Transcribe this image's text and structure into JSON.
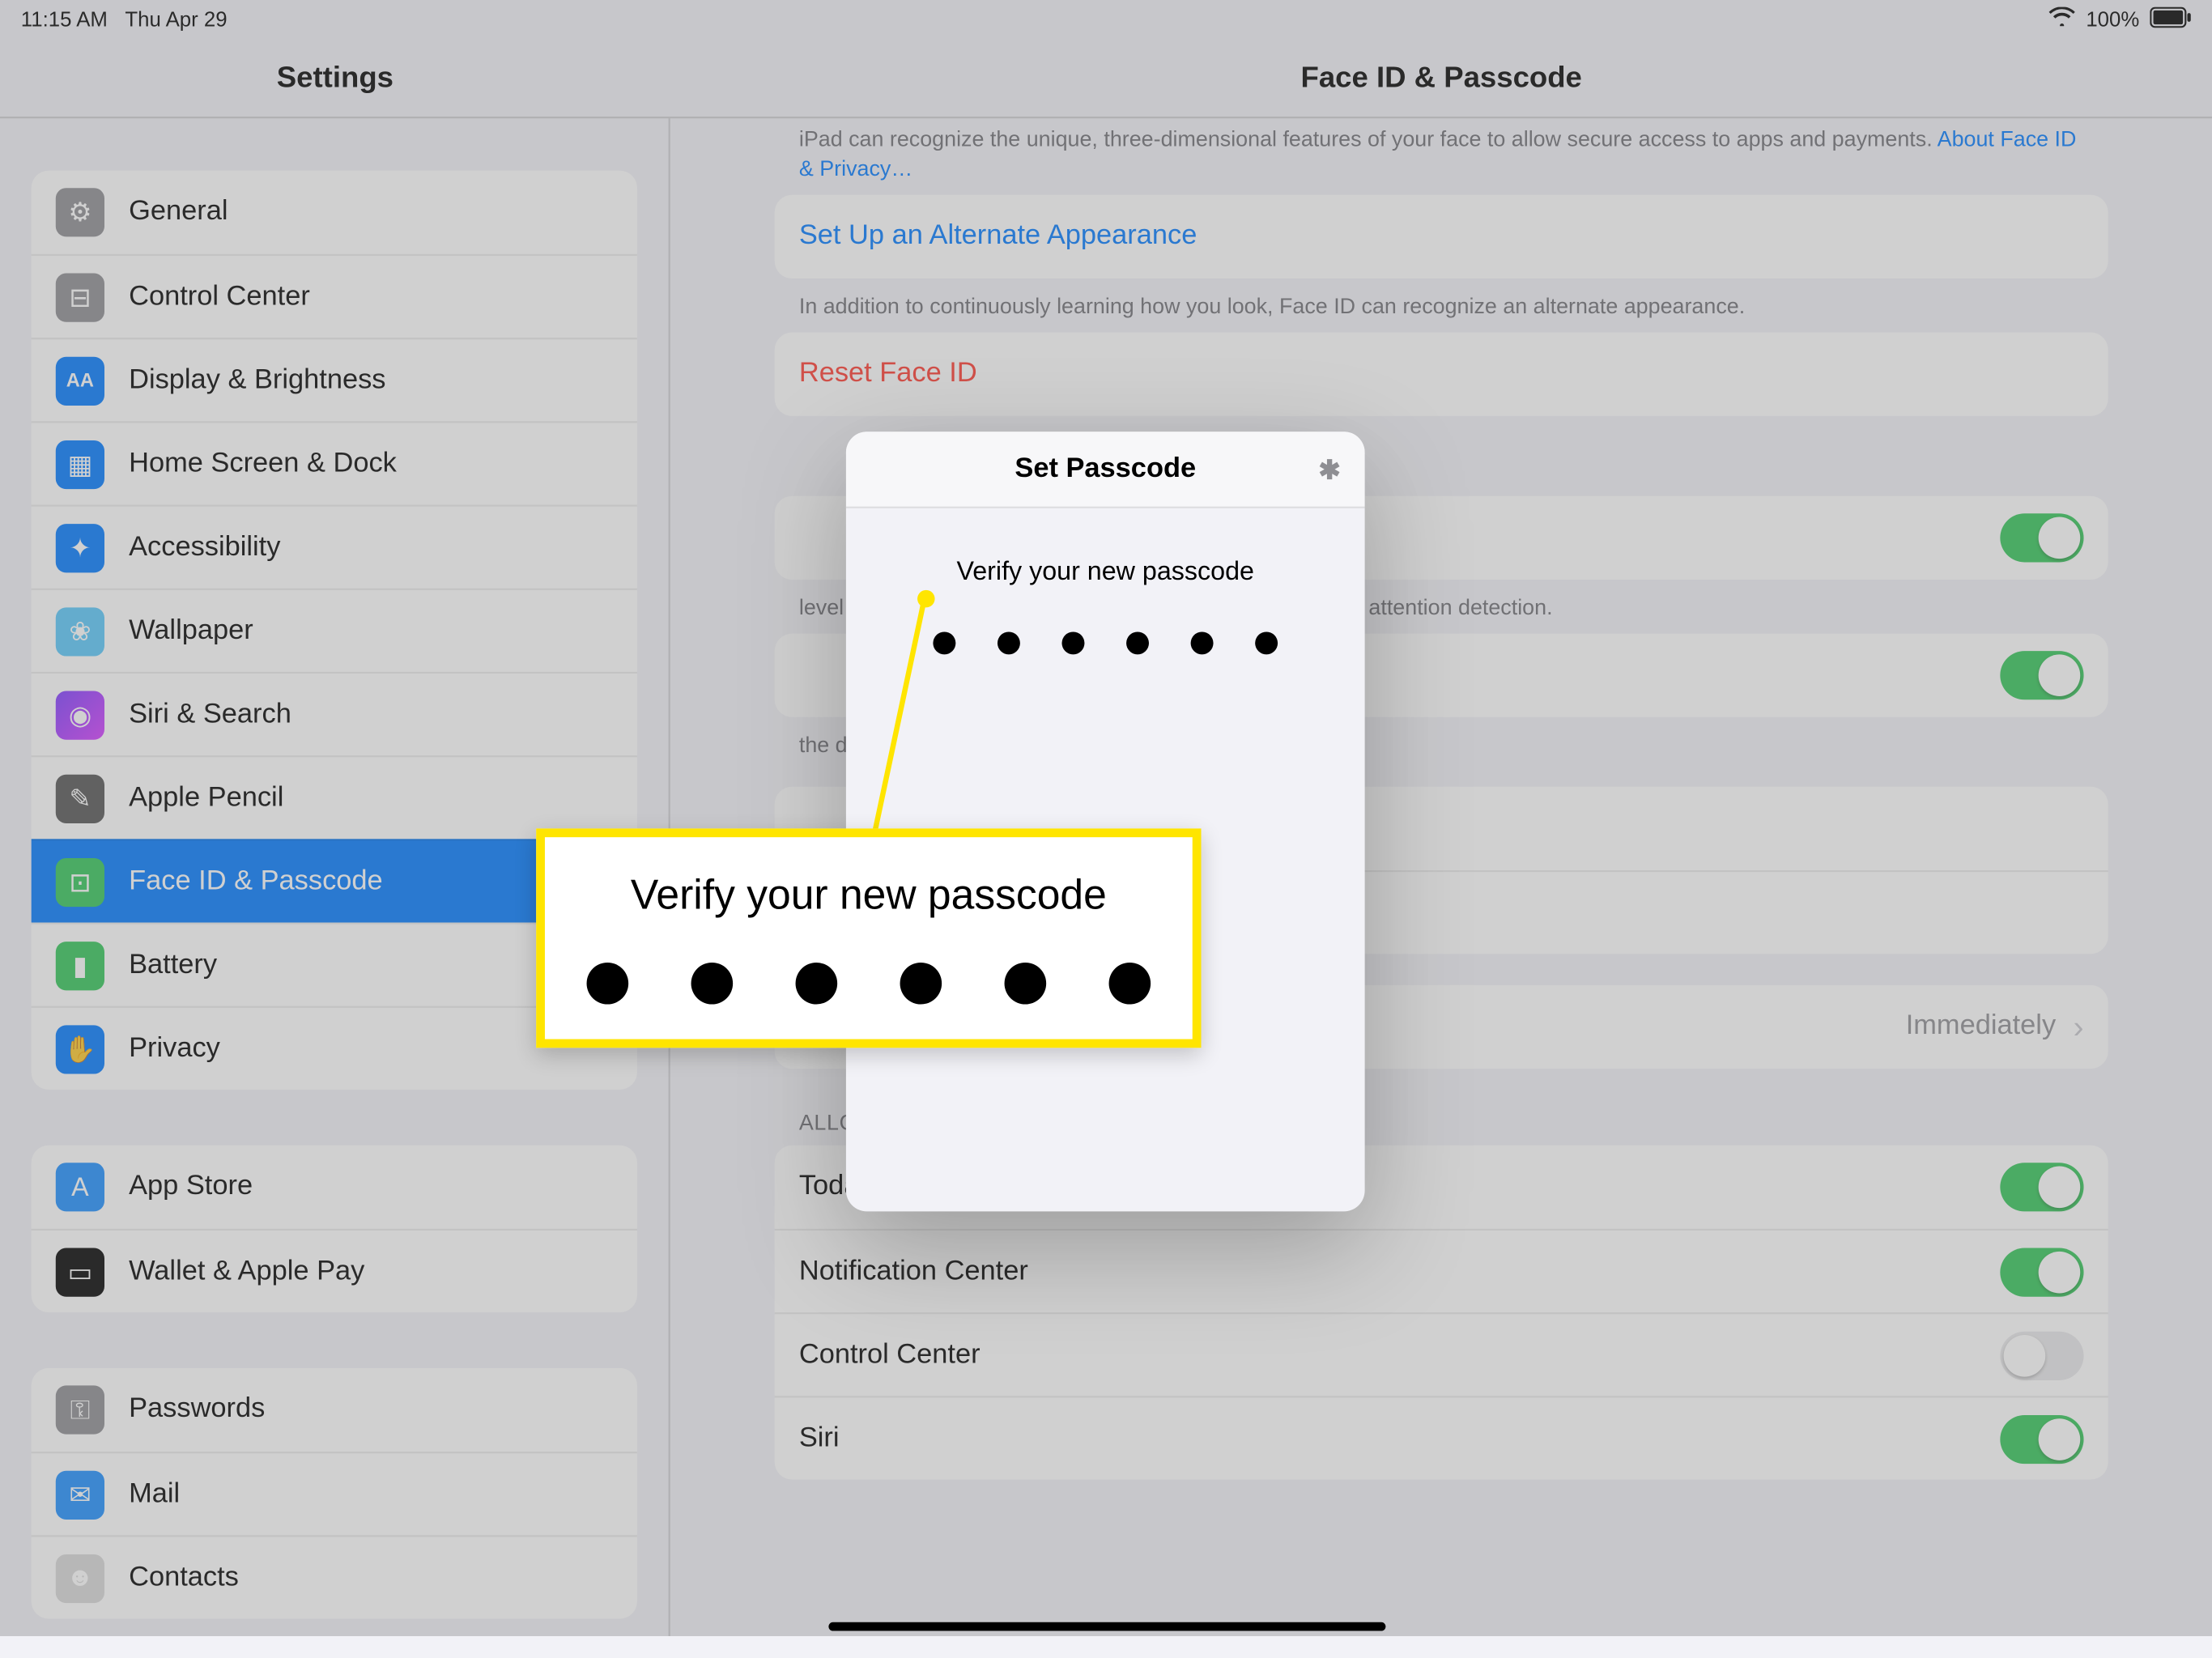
{
  "statusbar": {
    "time": "11:15 AM",
    "date": "Thu Apr 29",
    "battery": "100%"
  },
  "nav": {
    "left_title": "Settings",
    "right_title": "Face ID & Passcode"
  },
  "sidebar": {
    "groups": [
      [
        {
          "id": "general",
          "label": "General",
          "icon": "gear-icon",
          "cls": "gray",
          "glyph": "⚙"
        },
        {
          "id": "control-center",
          "label": "Control Center",
          "icon": "sliders-icon",
          "cls": "gray",
          "glyph": "⊟"
        },
        {
          "id": "display-brightness",
          "label": "Display & Brightness",
          "icon": "text-size-icon",
          "cls": "blue",
          "glyph": "AA"
        },
        {
          "id": "home-screen-dock",
          "label": "Home Screen & Dock",
          "icon": "grid-icon",
          "cls": "blue",
          "glyph": "▦"
        },
        {
          "id": "accessibility",
          "label": "Accessibility",
          "icon": "accessibility-icon",
          "cls": "blue",
          "glyph": "✦"
        },
        {
          "id": "wallpaper",
          "label": "Wallpaper",
          "icon": "flower-icon",
          "cls": "teal",
          "glyph": "❀"
        },
        {
          "id": "siri-search",
          "label": "Siri & Search",
          "icon": "siri-icon",
          "cls": "purple",
          "glyph": "◉"
        },
        {
          "id": "apple-pencil",
          "label": "Apple Pencil",
          "icon": "pencil-icon",
          "cls": "darkgray",
          "glyph": "✎"
        },
        {
          "id": "face-id-passcode",
          "label": "Face ID & Passcode",
          "icon": "faceid-icon",
          "cls": "faceid",
          "glyph": "⊡",
          "selected": true
        },
        {
          "id": "battery",
          "label": "Battery",
          "icon": "battery-icon",
          "cls": "green",
          "glyph": "▮"
        },
        {
          "id": "privacy",
          "label": "Privacy",
          "icon": "hand-icon",
          "cls": "blue",
          "glyph": "✋"
        }
      ],
      [
        {
          "id": "app-store",
          "label": "App Store",
          "icon": "appstore-icon",
          "cls": "appstore",
          "glyph": "A"
        },
        {
          "id": "wallet-apple-pay",
          "label": "Wallet & Apple Pay",
          "icon": "wallet-icon",
          "cls": "wallet",
          "glyph": "▭"
        }
      ],
      [
        {
          "id": "passwords",
          "label": "Passwords",
          "icon": "key-icon",
          "cls": "gray",
          "glyph": "⚿"
        },
        {
          "id": "mail",
          "label": "Mail",
          "icon": "mail-icon",
          "cls": "mail",
          "glyph": "✉"
        },
        {
          "id": "contacts",
          "label": "Contacts",
          "icon": "contacts-icon",
          "cls": "contacts",
          "glyph": "☻"
        }
      ]
    ]
  },
  "content": {
    "intro_caption_line1": "iPad can recognize the unique, three-dimensional features of your face to allow secure access to apps and payments. ",
    "intro_link": "About Face ID & Privacy…",
    "alt_appearance": "Set Up an Alternate Appearance",
    "alt_caption": "In addition to continuously learning how you look, Face ID can recognize an alternate appearance.",
    "reset_faceid": "Reset Face ID",
    "attention_caption": "level of security by verifying that you are looking at iPad ck attention detection.",
    "attention_aware_caption": "the display, expanding a notification when locked, or",
    "require_row_label": "",
    "require_value": "Immediately",
    "allow_header": "ALLOW ACCESS WHEN LOCKED:",
    "allow_rows": [
      {
        "label": "Today View",
        "on": true
      },
      {
        "label": "Notification Center",
        "on": true
      },
      {
        "label": "Control Center",
        "on": false
      },
      {
        "label": "Siri",
        "on": true
      }
    ]
  },
  "modal": {
    "title": "Set Passcode",
    "prompt": "Verify your new passcode"
  },
  "callout": {
    "text": "Verify your new passcode"
  }
}
